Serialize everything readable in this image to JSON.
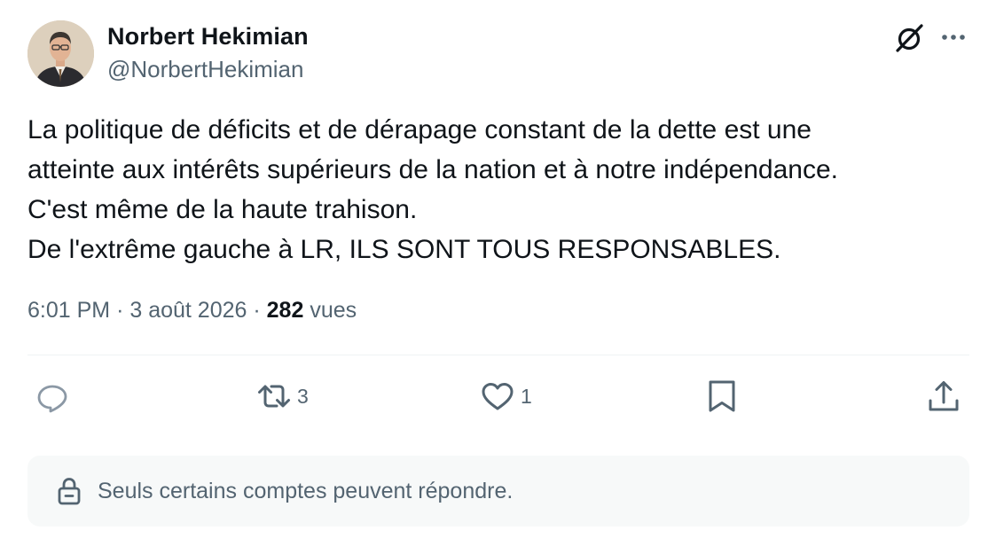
{
  "author": {
    "name": "Norbert Hekimian",
    "handle": "@NorbertHekimian",
    "avatar_icon": "profile-photo"
  },
  "header_actions": {
    "grok_icon": "grok-slashed-circle-icon",
    "more_icon": "more-horizontal-icon"
  },
  "tweet": {
    "lines": [
      "La politique de déficits et de dérapage constant de la dette est une",
      "atteinte aux intérêts supérieurs de la nation et à notre indépendance.",
      "C'est même de la haute trahison.",
      "De l'extrême gauche à LR, ILS SONT TOUS RESPONSABLES."
    ]
  },
  "meta": {
    "time": "6:01 PM",
    "separator": "·",
    "date": "3 août 2026",
    "views_count": "282",
    "views_label": "vues"
  },
  "actions": {
    "reply": {
      "icon": "reply-icon",
      "count": ""
    },
    "retweet": {
      "icon": "retweet-icon",
      "count": "3"
    },
    "like": {
      "icon": "heart-icon",
      "count": "1"
    },
    "bookmark": {
      "icon": "bookmark-icon",
      "count": ""
    },
    "share": {
      "icon": "share-icon",
      "count": ""
    }
  },
  "reply_restriction": {
    "icon": "lock-icon",
    "text": "Seuls certains comptes peuvent répondre."
  },
  "colors": {
    "text_primary": "#0f1419",
    "text_secondary": "#536471",
    "divider": "#eff3f4",
    "restriction_bg": "#f7f9f9"
  }
}
